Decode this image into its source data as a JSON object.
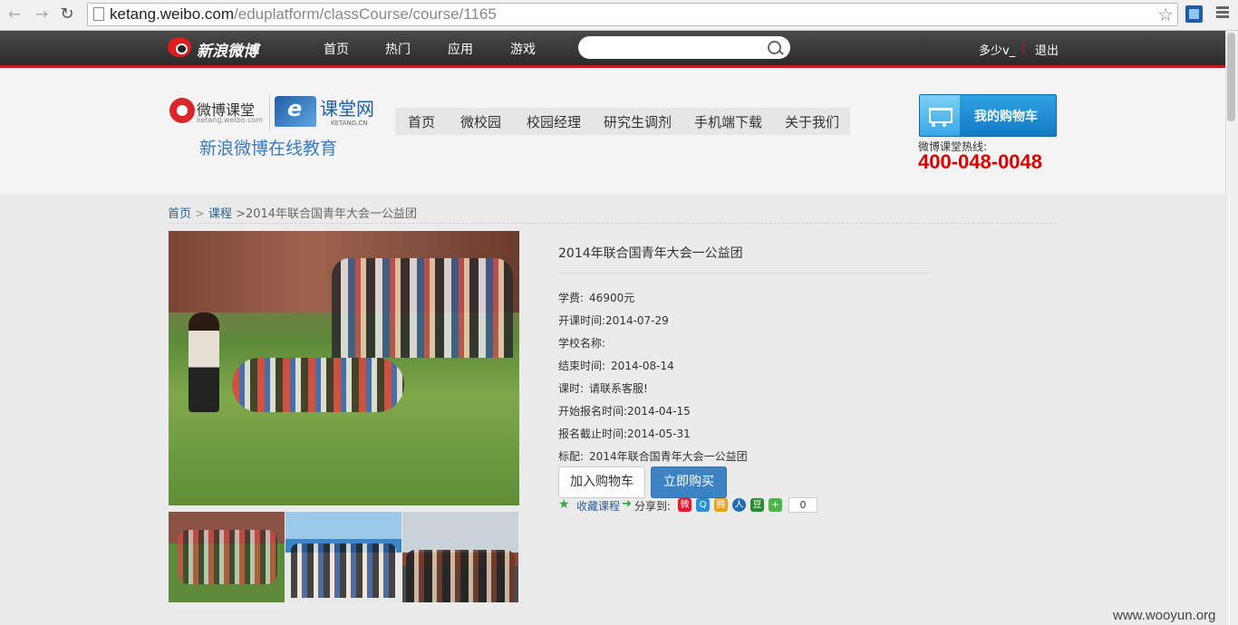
{
  "browser": {
    "url_host": "ketang.weibo.com",
    "url_path": "/eduplatform/classCourse/course/1165"
  },
  "weibo_bar": {
    "logo_text": "新浪微博",
    "nav": [
      "首页",
      "热门",
      "应用",
      "游戏"
    ],
    "user": "多少v_",
    "separator": "|",
    "logout": "退出"
  },
  "header": {
    "ketang_logo": "微博课堂",
    "ketang_logo_url": "ketang.weibo.com",
    "ketangwang_logo": "课堂网",
    "ketangwang_logo_url": "KETANG.CN",
    "slogan": "新浪微博在线教育",
    "nav": [
      "首页",
      "微校园",
      "校园经理",
      "研究生调剂",
      "手机端下载",
      "关于我们"
    ],
    "cart_button": "我的购物车",
    "hotline_label": "微博课堂热线:",
    "hotline": "400-048-0048"
  },
  "breadcrumb": {
    "home": "首页",
    "sep": ">",
    "course": "课程",
    "current": ">2014年联合国青年大会一公益团"
  },
  "course": {
    "title": "2014年联合国青年大会一公益团",
    "fields": [
      {
        "label": "学费:",
        "value": "46900元"
      },
      {
        "label": "开课时间:",
        "value": "2014-07-29"
      },
      {
        "label": "学校名称:",
        "value": ""
      },
      {
        "label": "结束时间:",
        "value": "2014-08-14"
      },
      {
        "label": "课时:",
        "value": "请联系客服!"
      },
      {
        "label": "开始报名时间:",
        "value": "2014-04-15"
      },
      {
        "label": "报名截止时间:",
        "value": "2014-05-31"
      },
      {
        "label": "标配:",
        "value": "2014年联合国青年大会一公益团"
      }
    ],
    "add_to_cart": "加入购物车",
    "buy_now": "立即购买",
    "favorite": "收藏课程",
    "share_label": "分享到:",
    "share_count": "0",
    "share_icons": [
      {
        "name": "sina-weibo-icon",
        "glyph": "微",
        "color": "#e6162d"
      },
      {
        "name": "qzone-icon",
        "glyph": "Q",
        "color": "#2b8fd8"
      },
      {
        "name": "tencent-weibo-icon",
        "glyph": "腾",
        "color": "#e8a21b"
      },
      {
        "name": "renren-icon",
        "glyph": "人",
        "color": "#1f6cb5"
      },
      {
        "name": "douban-icon",
        "glyph": "豆",
        "color": "#2a8c30"
      },
      {
        "name": "more-share-icon",
        "glyph": "+",
        "color": "#4cb64a"
      }
    ]
  },
  "watermark": "www.wooyun.org"
}
